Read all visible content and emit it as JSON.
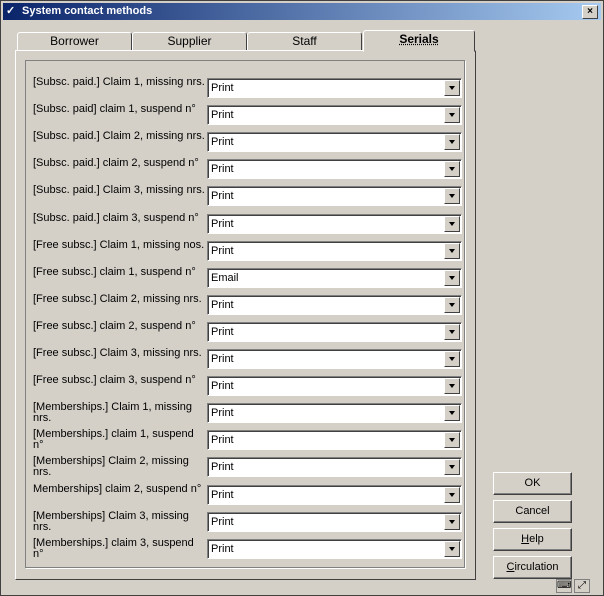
{
  "window": {
    "title": "System contact methods",
    "close_label": "×"
  },
  "tabs": [
    {
      "label": "Borrower",
      "active": false
    },
    {
      "label": "Supplier",
      "active": false
    },
    {
      "label": "Staff",
      "active": false
    },
    {
      "label": "Serials",
      "active": true
    }
  ],
  "rows": [
    {
      "label": "[Subsc. paid.] Claim 1, missing nrs.",
      "value": "Print"
    },
    {
      "label": "[Subsc. paid] claim 1, suspend n°",
      "value": "Print"
    },
    {
      "label": "[Subsc. paid.] Claim 2, missing nrs.",
      "value": "Print"
    },
    {
      "label": "[Subsc. paid.] claim 2, suspend n°",
      "value": "Print"
    },
    {
      "label": "[Subsc. paid.] Claim 3, missing nrs.",
      "value": "Print"
    },
    {
      "label": "[Subsc. paid.] claim 3, suspend n°",
      "value": "Print"
    },
    {
      "label": "[Free subsc.] Claim 1, missing nos.",
      "value": "Print"
    },
    {
      "label": "[Free subsc.] claim 1, suspend n°",
      "value": "Email"
    },
    {
      "label": "[Free subsc.] Claim 2, missing nrs.",
      "value": "Print"
    },
    {
      "label": "[Free subsc.] claim 2, suspend n°",
      "value": "Print"
    },
    {
      "label": "[Free subsc.] Claim 3, missing nrs.",
      "value": "Print"
    },
    {
      "label": "[Free subsc.] claim 3, suspend n°",
      "value": "Print"
    },
    {
      "label": "[Memberships.] Claim 1, missing nrs.",
      "value": "Print"
    },
    {
      "label": "[Memberships.] claim 1, suspend n°",
      "value": "Print"
    },
    {
      "label": "[Memberships] Claim 2, missing nrs.",
      "value": "Print"
    },
    {
      "label": "Memberships] claim 2, suspend n°",
      "value": "Print"
    },
    {
      "label": "[Memberships] Claim 3, missing nrs.",
      "value": "Print"
    },
    {
      "label": "[Memberships.] claim 3, suspend n°",
      "value": "Print"
    }
  ],
  "buttons": {
    "ok": "OK",
    "cancel": "Cancel",
    "help_underline": "H",
    "help_rest": "elp",
    "circulation_underline": "C",
    "circulation_rest": "irculation"
  },
  "icons": {
    "app": "library-icon",
    "status": [
      "keyboard-icon",
      "resize-grip-icon"
    ]
  }
}
